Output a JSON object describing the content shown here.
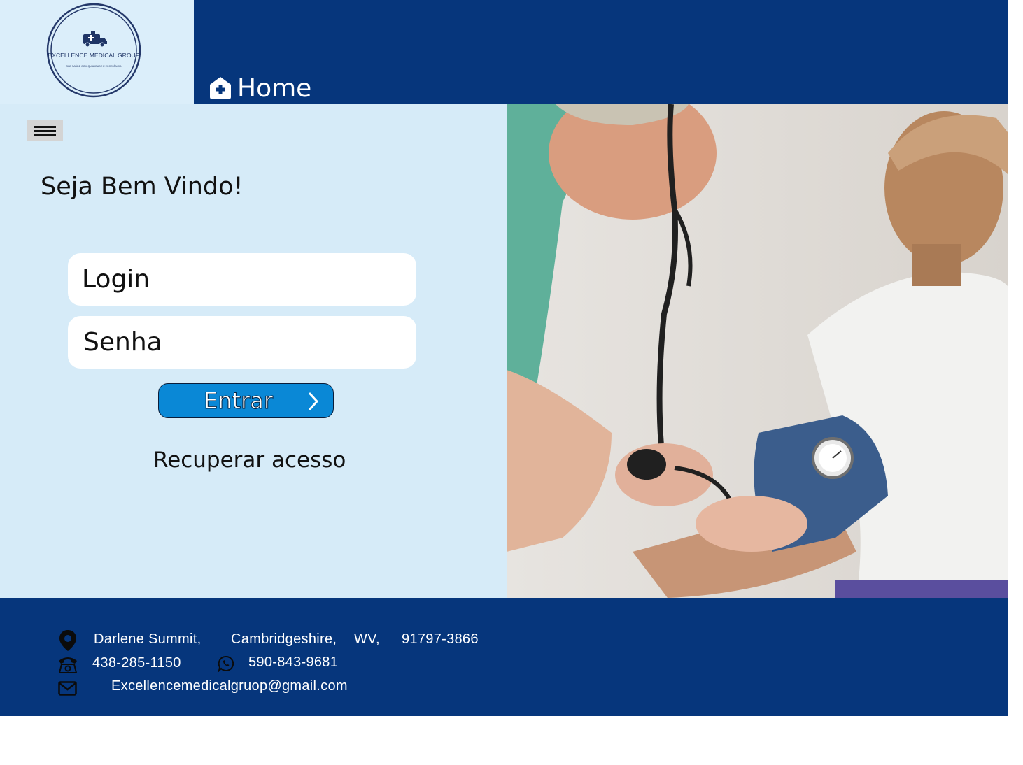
{
  "header": {
    "logo": {
      "title": "EXCELLENCE MEDICAL GROUP",
      "tagline": "SUA SAÚDE COM QUALIDADE E EXCELÊNCIA"
    },
    "nav": {
      "home_label": "Home",
      "home_icon": "house-medical-icon"
    }
  },
  "main": {
    "menu_icon": "hamburger-menu-icon",
    "welcome": "Seja Bem Vindo!",
    "login_placeholder": "Login",
    "password_placeholder": "Senha",
    "submit_label": "Entrar",
    "recover_label": "Recuperar acesso"
  },
  "footer": {
    "address": {
      "street": "Darlene Summit,",
      "city": "Cambridgeshire,",
      "state": "WV,",
      "zip": "91797-3866"
    },
    "phone": "438-285-1150",
    "whatsapp": "590-843-9681",
    "email": "Excellencemedicalgruop@gmail.com"
  },
  "colors": {
    "brand_dark": "#06367c",
    "panel_light": "#d6ebf8",
    "logo_bg": "#dbeefa",
    "button_blue": "#0a88d6"
  }
}
